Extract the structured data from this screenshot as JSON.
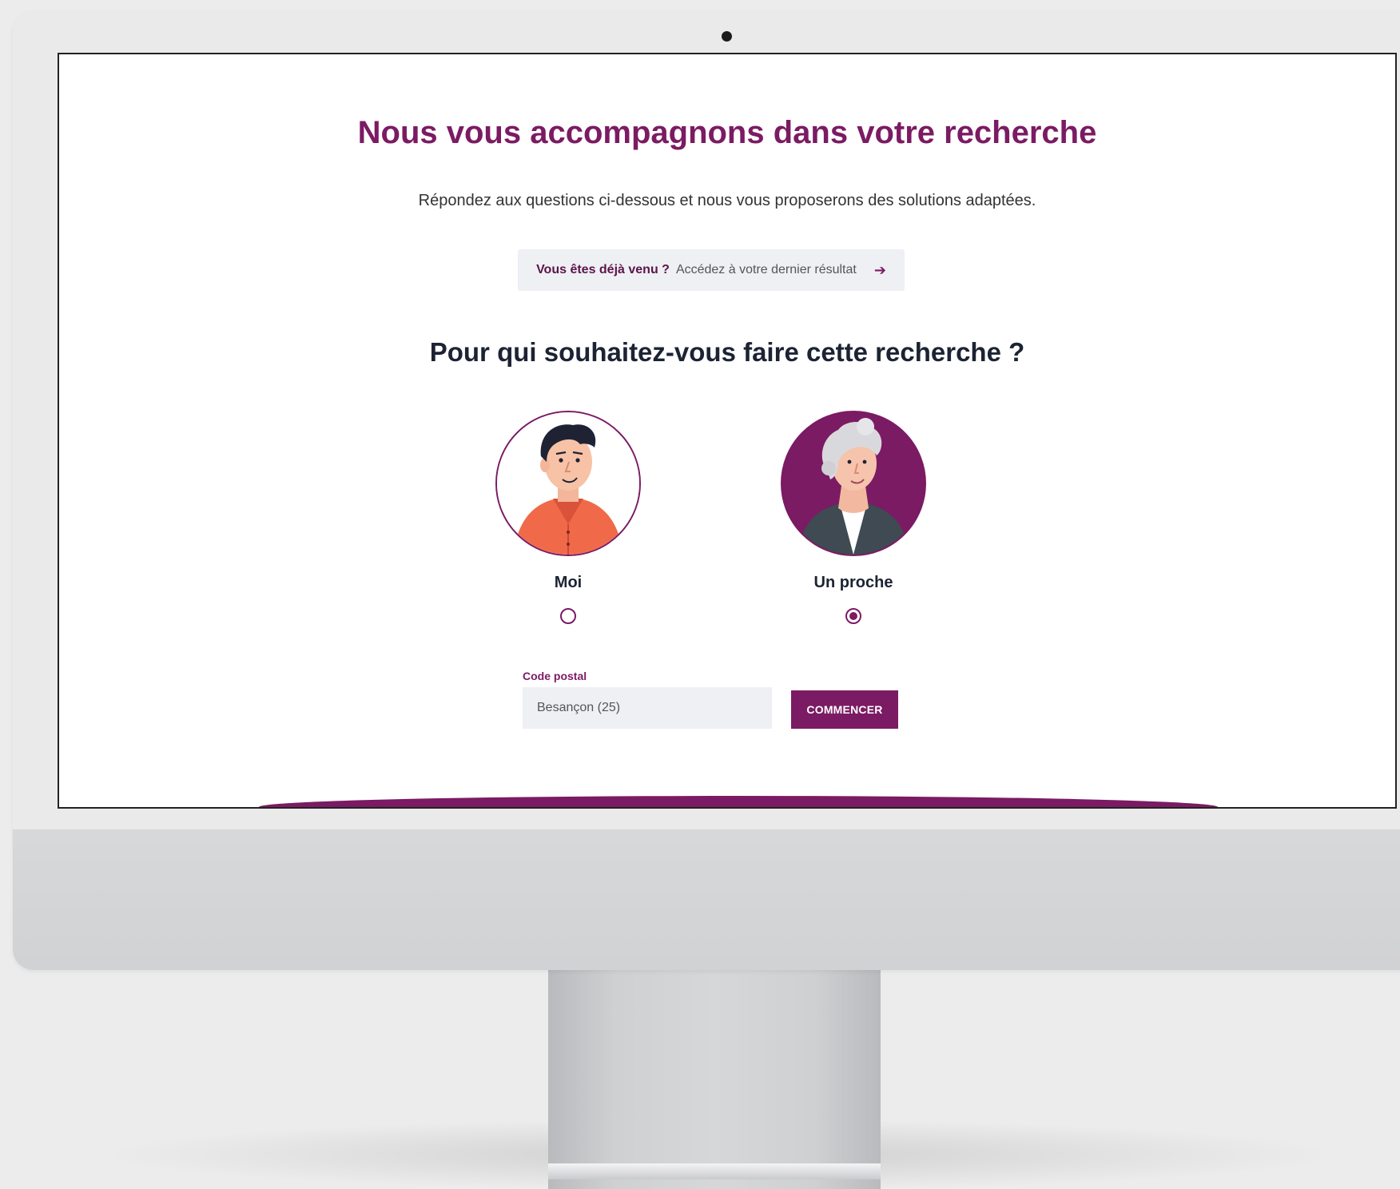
{
  "colors": {
    "brand": "#7b1b63",
    "heading": "#1c2333",
    "field_background": "#eef0f4"
  },
  "hero": {
    "title": "Nous vous accompagnons dans votre recherche",
    "subtitle": "Répondez aux questions ci-dessous et nous vous proposerons des solutions adaptées."
  },
  "returning": {
    "bold_text": "Vous êtes déjà venu ?",
    "link_text": "Accédez à votre dernier résultat",
    "icon": "arrow-right-icon"
  },
  "question": {
    "title": "Pour qui souhaitez-vous faire cette recherche ?",
    "options": [
      {
        "label": "Moi",
        "selected": false,
        "avatar": "young-man-avatar"
      },
      {
        "label": "Un proche",
        "selected": true,
        "avatar": "elderly-woman-avatar"
      }
    ]
  },
  "postal": {
    "label": "Code postal",
    "value": "Besançon (25)"
  },
  "actions": {
    "start_label": "COMMENCER"
  }
}
